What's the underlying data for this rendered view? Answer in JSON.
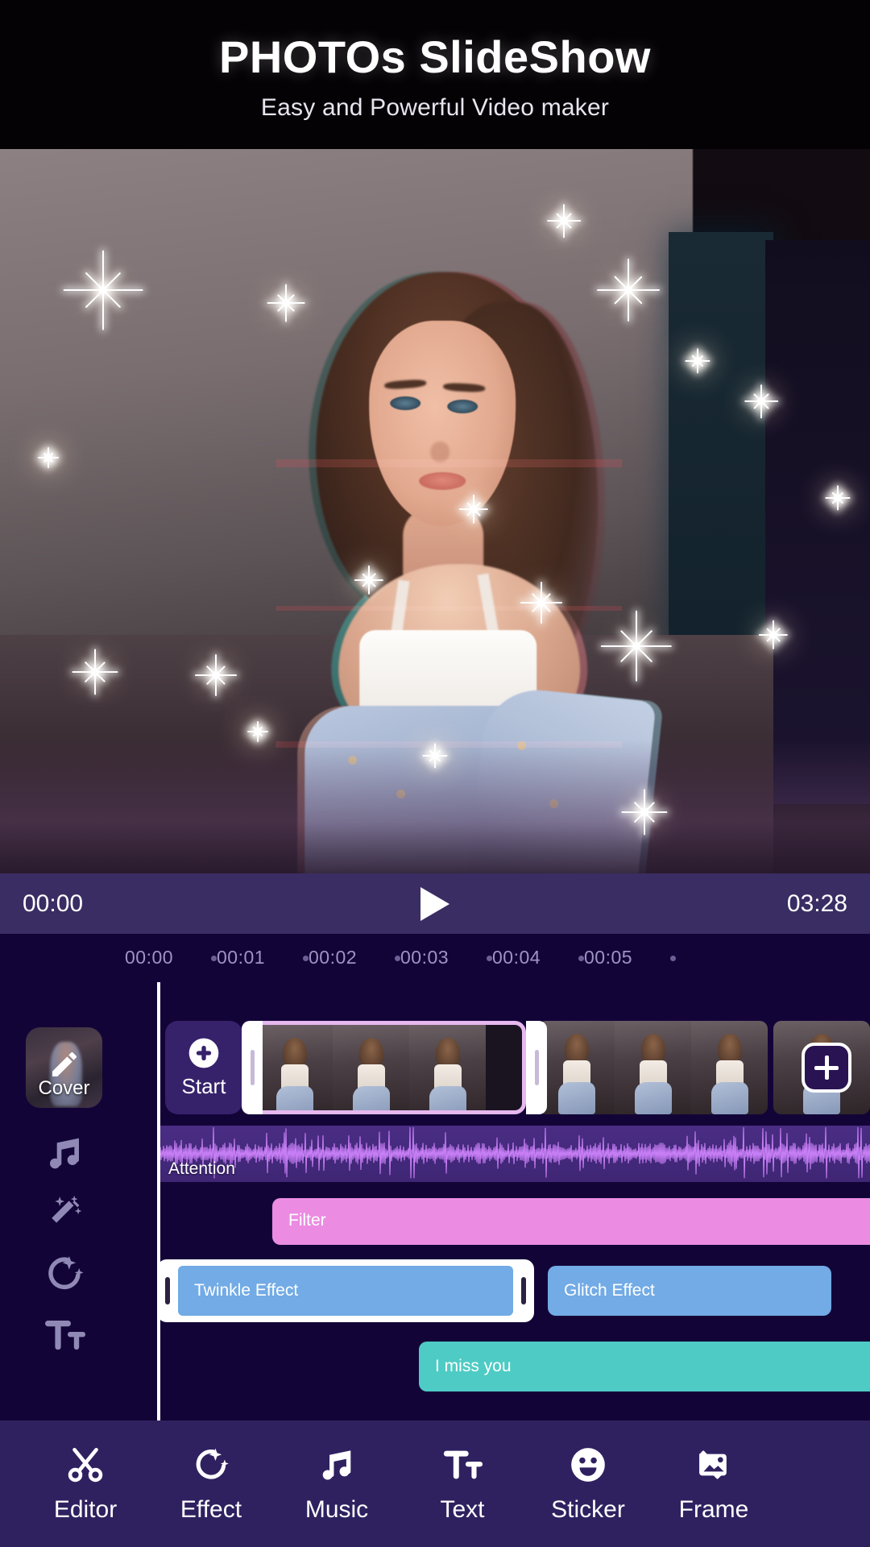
{
  "header": {
    "title": "PHOTOs SlideShow",
    "subtitle": "Easy and Powerful Video maker"
  },
  "player": {
    "current_time": "00:00",
    "total_time": "03:28",
    "play_icon": "play-icon",
    "state": "paused"
  },
  "timeline": {
    "ruler_ticks": [
      "00:00",
      "00:01",
      "00:02",
      "00:03",
      "00:04",
      "00:05"
    ],
    "cover": {
      "label": "Cover",
      "icon": "pencil-icon"
    },
    "start_button": {
      "label": "Start",
      "icon": "plus-circle-icon"
    },
    "add_button": {
      "icon": "plus-icon"
    },
    "rail_icons": [
      "music-note-icon",
      "magic-wand-icon",
      "sparkle-effect-icon",
      "text-tt-icon"
    ],
    "video_clips": [
      {
        "name": "clip-1",
        "frames": 3,
        "selected": true
      },
      {
        "name": "clip-2",
        "frames": 3,
        "selected": false
      },
      {
        "name": "clip-3",
        "frames": 1,
        "selected": false
      }
    ],
    "audio_track": {
      "label": "Attention",
      "color": "#4a2d84"
    },
    "filter_track": {
      "label": "Filter",
      "color": "#eb8ce2"
    },
    "effect_tracks": [
      {
        "label": "Twinkle Effect",
        "color": "#72abe5",
        "selected": true
      },
      {
        "label": "Glitch Effect",
        "color": "#72abe5",
        "selected": false
      }
    ],
    "text_track": {
      "label": "I miss you",
      "color": "#4ecbc4"
    }
  },
  "bottom_nav": {
    "items": [
      {
        "label": "Editor",
        "icon": "scissors-icon"
      },
      {
        "label": "Effect",
        "icon": "sparkle-effect-icon"
      },
      {
        "label": "Music",
        "icon": "music-note-icon"
      },
      {
        "label": "Text",
        "icon": "text-tt-icon"
      },
      {
        "label": "Sticker",
        "icon": "smiley-icon"
      },
      {
        "label": "Frame",
        "icon": "frame-picture-icon"
      }
    ]
  },
  "colors": {
    "player_bar": "#3a2d63",
    "timeline_bg": "#130438",
    "bottom_nav": "#2f2160",
    "selection_border": "#e6b8ef",
    "playhead": "#ffffff"
  }
}
